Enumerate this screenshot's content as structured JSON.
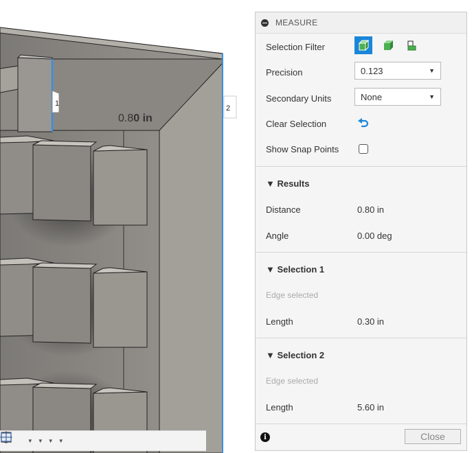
{
  "viewport": {
    "dimension_value": "0.8",
    "dimension_value_bold": "0 in",
    "marker_1": "1",
    "marker_2": "2",
    "colors": {
      "model": "#8f8c86",
      "model_dark": "#5e5c58",
      "highlight": "#3a8fe0"
    },
    "toolbar_icons": [
      "orbit-icon",
      "look-at-icon",
      "pan-icon",
      "zoom-icon",
      "fit-icon",
      "display-settings-icon",
      "grid-icon",
      "viewports-icon"
    ]
  },
  "panel": {
    "title": "MEASURE",
    "selection_filter_label": "Selection Filter",
    "filter_icons": [
      "body-filter-icon",
      "face-filter-icon",
      "edge-filter-icon"
    ],
    "precision_label": "Precision",
    "precision_value": "0.123",
    "secondary_units_label": "Secondary Units",
    "secondary_units_value": "None",
    "clear_selection_label": "Clear Selection",
    "show_snap_points_label": "Show Snap Points",
    "results": {
      "header": "Results",
      "distance_label": "Distance",
      "distance_value": "0.80 in",
      "angle_label": "Angle",
      "angle_value": "0.00 deg"
    },
    "selection1": {
      "header": "Selection 1",
      "status": "Edge selected",
      "length_label": "Length",
      "length_value": "0.30 in"
    },
    "selection2": {
      "header": "Selection 2",
      "status": "Edge selected",
      "length_label": "Length",
      "length_value": "5.60 in"
    },
    "close_label": "Close",
    "accent": "#1a86d9"
  }
}
